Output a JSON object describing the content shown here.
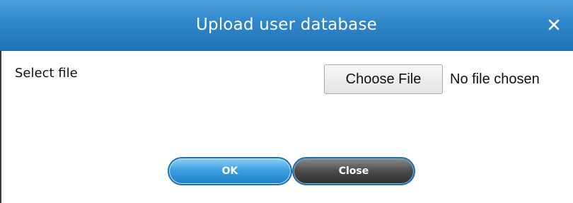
{
  "dialog": {
    "title": "Upload user database",
    "close_icon": "close-x-icon"
  },
  "form": {
    "select_file_label": "Select file",
    "choose_file_button": "Choose File",
    "no_file_text": "No file chosen"
  },
  "actions": {
    "ok_label": "OK",
    "close_label": "Close"
  },
  "colors": {
    "titlebar": "#2e86c9",
    "ok_button": "#3ea0e0",
    "close_button": "#4c4c4c"
  }
}
